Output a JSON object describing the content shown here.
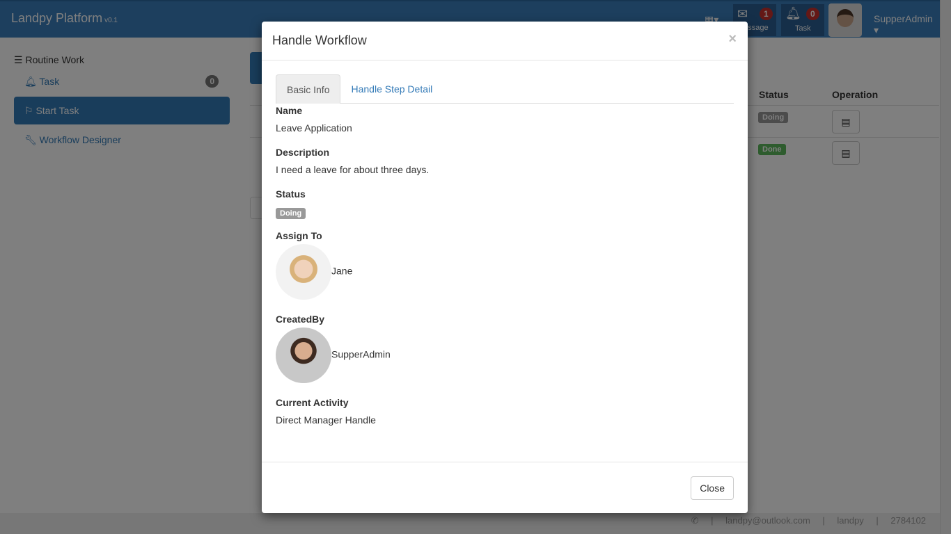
{
  "navbar": {
    "brand": "Landpy Platform",
    "version": "v0.1",
    "message_label": "Message",
    "message_count": "1",
    "task_label": "Task",
    "task_count": "0",
    "user": "SupperAdmin"
  },
  "sidebar": {
    "heading": "Routine Work",
    "items": [
      {
        "label": "Task",
        "badge": "0"
      },
      {
        "label": "Start Task"
      },
      {
        "label": "Workflow Designer"
      }
    ]
  },
  "table": {
    "headers": {
      "status": "Status",
      "operation": "Operation"
    },
    "rows": [
      {
        "status": "Doing"
      },
      {
        "status": "Done"
      }
    ]
  },
  "footer": {
    "email": "landpy@outlook.com",
    "qq_name": "landpy",
    "qq_number": "2784102"
  },
  "modal": {
    "title": "Handle Workflow",
    "close_x": "×",
    "tabs": [
      "Basic Info",
      "Handle Step Detail"
    ],
    "fields": {
      "name_label": "Name",
      "name": "Leave Application",
      "desc_label": "Description",
      "desc": "I need a leave for about three days.",
      "status_label": "Status",
      "status": "Doing",
      "assign_label": "Assign To",
      "assign": "Jane",
      "created_label": "CreatedBy",
      "created": "SupperAdmin",
      "activity_label": "Current Activity",
      "activity": "Direct Manager Handle"
    },
    "close_button": "Close"
  },
  "colors": {
    "primary": "#337ab7",
    "doing": "#999999",
    "done": "#5cb85c"
  }
}
